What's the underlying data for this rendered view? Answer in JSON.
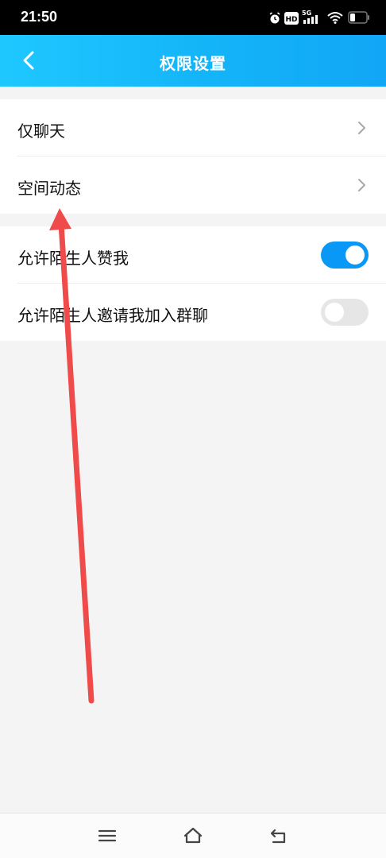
{
  "status_bar": {
    "time": "21:50",
    "icons": [
      "alarm-icon",
      "hd-icon",
      "signal-5g-icon",
      "wifi-icon",
      "battery-icon"
    ],
    "hd_label": "HD",
    "network_label": "5G"
  },
  "header": {
    "title": "权限设置",
    "back_icon": "chevron-left-icon",
    "gradient_colors": [
      "#1ec8ff",
      "#11a6f6"
    ]
  },
  "section1": {
    "items": [
      {
        "label": "仅聊天",
        "icon": "chevron-right-icon"
      },
      {
        "label": "空间动态",
        "icon": "chevron-right-icon"
      }
    ]
  },
  "section2": {
    "items": [
      {
        "label": "允许陌生人赞我",
        "toggle": true
      },
      {
        "label": "允许陌生人邀请我加入群聊",
        "toggle": false
      }
    ]
  },
  "nav_bar": {
    "buttons": [
      "menu-icon",
      "home-icon",
      "back-icon"
    ]
  },
  "colors": {
    "toggle_on": "#0a98f7",
    "toggle_off": "#e6e6e6",
    "annotation_arrow": "#f04b4b",
    "background": "#f4f4f4"
  }
}
